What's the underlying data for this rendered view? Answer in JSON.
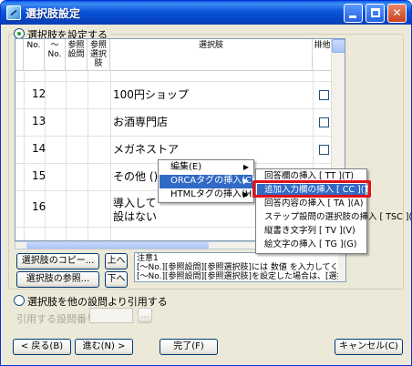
{
  "window": {
    "title": "選択肢設定",
    "controls": {
      "minimize": "minimize",
      "maximize": "maximize",
      "close": "✕"
    }
  },
  "options": {
    "set_choices_label": "選択肢を設定する",
    "ref_other_label": "選択肢を他の設問より引用する",
    "ref_number_label": "引用する設問番号:",
    "browse_label": "..."
  },
  "grid": {
    "headers": {
      "no": "No.",
      "range": "〜No.",
      "ref_question": "参照設問",
      "ref_choice": "参照選択肢",
      "choice": "選択肢",
      "exclusive": "排他"
    },
    "rows": [
      {
        "no": "12",
        "text": "100円ショップ"
      },
      {
        "no": "13",
        "text": "お酒専門店"
      },
      {
        "no": "14",
        "text": "メガネストア"
      },
      {
        "no": "15",
        "text": "その他 ()"
      },
      {
        "no": "16",
        "text": "導入して",
        "text2": "設はない"
      }
    ]
  },
  "buttons": {
    "copy": "選択肢のコピー...",
    "up": "上へ",
    "ref": "選択肢の参照...",
    "down": "下へ",
    "back": "< 戻る(B)",
    "next": "進む(N) >",
    "finish": "完了(F)",
    "cancel": "キャンセル(C)"
  },
  "note": {
    "line1": "注意1",
    "line2": "[〜No.][参照設問][参照選択肢]には 数値 を入力してくださ",
    "line3": "[〜No.][参照設問][参照選択肢]を設定した場合は、[選択肢"
  },
  "context_menu": {
    "items": [
      {
        "label": "編集(E)",
        "arrow": "▶"
      },
      {
        "label": "ORCAタグの挿入(C)",
        "arrow": "▶"
      },
      {
        "label": "HTMLタグの挿入(H)",
        "arrow": "▶"
      }
    ]
  },
  "submenu": {
    "items": [
      {
        "label": "回答欄の挿入 [ TT ](T)"
      },
      {
        "label": "追加入力欄の挿入 [ CC ](T)"
      },
      {
        "label": "回答内容の挿入 [ TA ](A)"
      },
      {
        "label": "ステップ設問の選択肢の挿入 [ TSC ](S)"
      },
      {
        "label": "縦書き文字列 [ TV ](V)"
      },
      {
        "label": "絵文字の挿入 [ TG ](G)"
      }
    ]
  },
  "colors": {
    "titlebar": "#0a55d8",
    "menu_highlight": "#316ac5",
    "callout_border": "#e0101a"
  }
}
